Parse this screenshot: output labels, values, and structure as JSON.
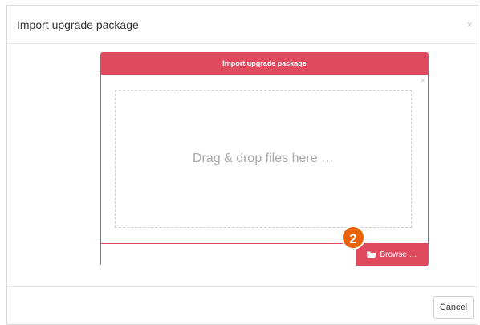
{
  "dialog": {
    "title": "Import upgrade package",
    "close_symbol": "×",
    "cancel_label": "Cancel"
  },
  "upload": {
    "header_title": "Import upgrade package",
    "close_symbol": "×",
    "dropzone_text": "Drag & drop files here …",
    "file_input_value": "",
    "browse_label": "Browse …",
    "browse_icon": "folder-open-icon"
  },
  "annotation": {
    "step_number": "2"
  },
  "colors": {
    "accent": "#e04a5f",
    "badge": "#e8620c"
  }
}
